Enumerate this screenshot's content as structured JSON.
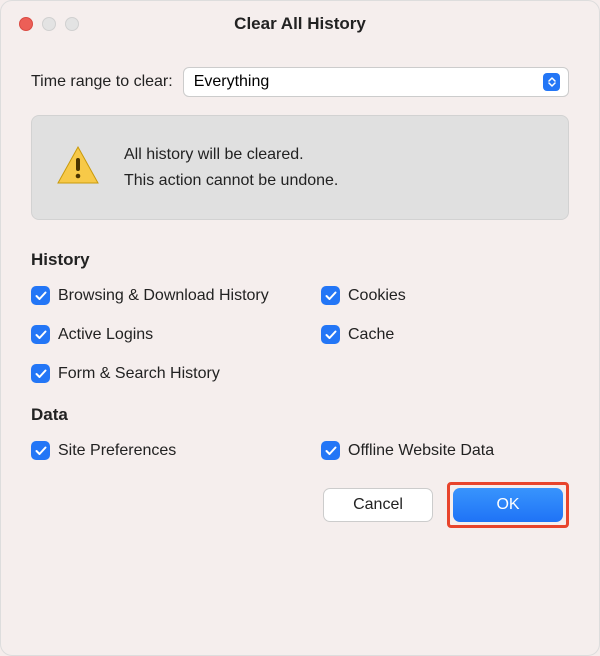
{
  "window": {
    "title": "Clear All History"
  },
  "range": {
    "label": "Time range to clear:",
    "value": "Everything"
  },
  "warning": {
    "line1": "All history will be cleared.",
    "line2": "This action cannot be undone."
  },
  "sections": {
    "history": {
      "heading": "History",
      "items": {
        "browsing": "Browsing & Download History",
        "cookies": "Cookies",
        "active_logins": "Active Logins",
        "cache": "Cache",
        "form_search": "Form & Search History"
      }
    },
    "data": {
      "heading": "Data",
      "items": {
        "site_prefs": "Site Preferences",
        "offline": "Offline Website Data"
      }
    }
  },
  "buttons": {
    "cancel": "Cancel",
    "ok": "OK"
  }
}
